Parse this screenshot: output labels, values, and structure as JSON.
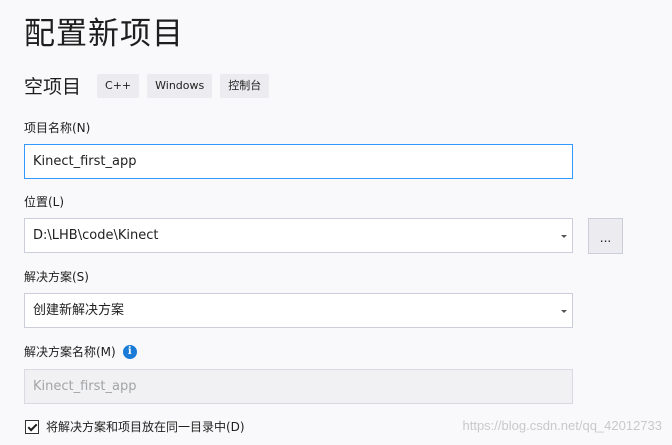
{
  "header": {
    "title": "配置新项目",
    "subtitle": "空项目",
    "tags": [
      "C++",
      "Windows",
      "控制台"
    ]
  },
  "form": {
    "project_name": {
      "label": "项目名称(N)",
      "value": "Kinect_first_app"
    },
    "location": {
      "label": "位置(L)",
      "value": "D:\\LHB\\code\\Kinect",
      "browse_label": "..."
    },
    "solution": {
      "label": "解决方案(S)",
      "value": "创建新解决方案"
    },
    "solution_name": {
      "label": "解决方案名称(M)",
      "value": "Kinect_first_app",
      "info_glyph": "i"
    },
    "same_dir_checkbox": {
      "label": "将解决方案和项目放在同一目录中(D)",
      "checked": true
    }
  },
  "watermark": "https://blog.csdn.net/qq_42012733",
  "colors": {
    "background": "#f9f9fb",
    "focus_border": "#3399ff",
    "info_icon": "#1a7cd6",
    "tag_background": "#ececf0"
  }
}
